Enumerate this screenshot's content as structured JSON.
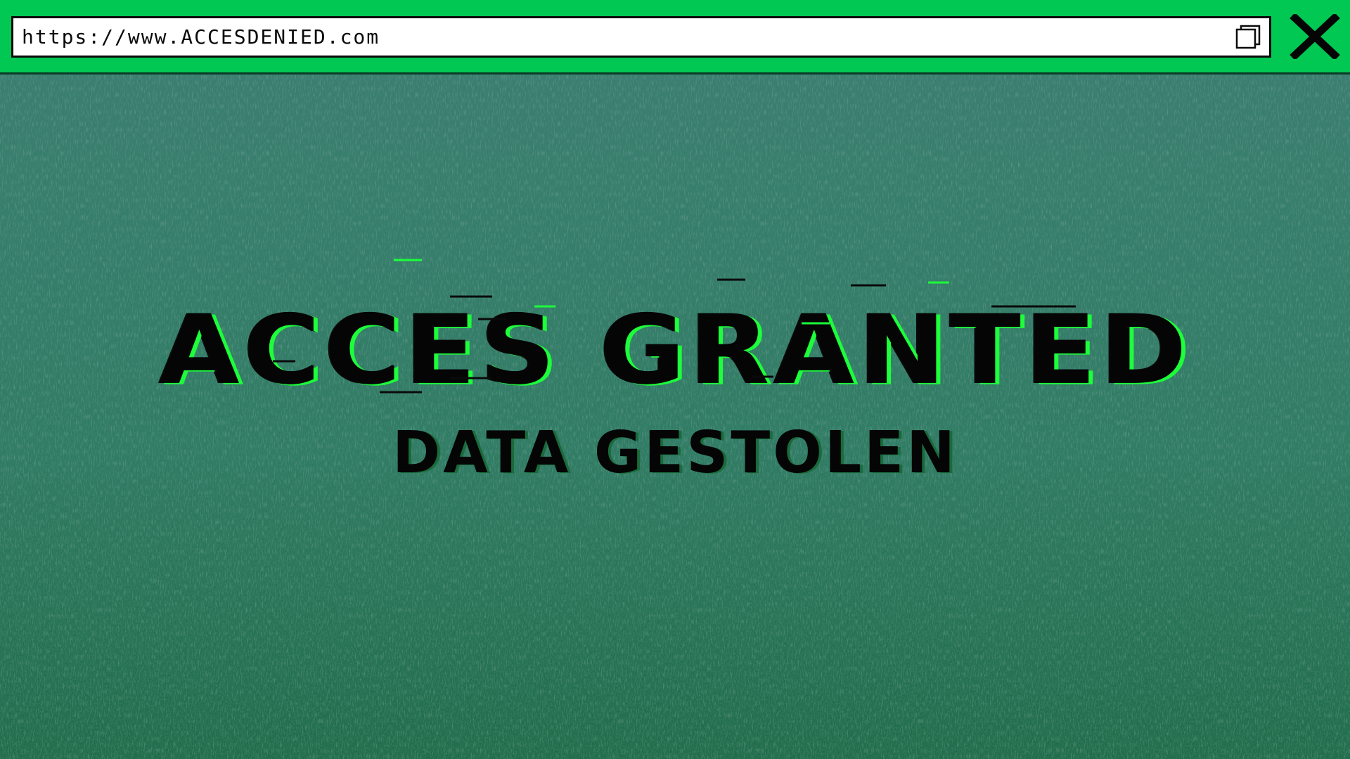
{
  "address_bar": {
    "url": "https://www.ACCESDENIED.com"
  },
  "main": {
    "headline": "ACCES GRANTED",
    "subline": "DATA GESTOLEN"
  },
  "icons": {
    "copy": "copy-icon",
    "close": "close-icon"
  },
  "colors": {
    "top_bar": "#00c853",
    "background": "#2f7a62",
    "text": "#050505",
    "glitch_accent": "#1cff3a"
  }
}
